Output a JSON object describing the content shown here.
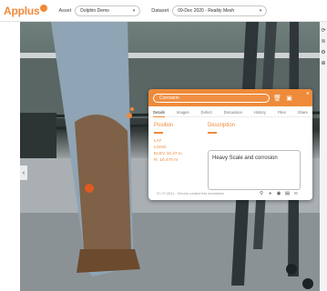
{
  "header": {
    "logo": "Applus",
    "asset_label": "Asset",
    "asset_value": "Dolphin Demo",
    "dataset_label": "Dataset",
    "dataset_value": "09-Dec 2020 - Reality Mesh"
  },
  "toolbar": {
    "icons": [
      "refresh-icon",
      "layers-icon",
      "settings-icon",
      "zoom-icon"
    ]
  },
  "dialog": {
    "title": "Corrosion",
    "tabs": [
      "Details",
      "Images",
      "Defect",
      "Discussion",
      "History",
      "Files",
      "Share"
    ],
    "active_tab": "Details",
    "position_label": "Position",
    "lat_label": "LAT",
    "long_label": "LONG",
    "elev_label": "ELEV 10.47 m",
    "r_label": "R: 10.470 m",
    "description_label": "Description",
    "description_text": "Heavy Scale and corrosion",
    "footer_text": "07-07-2021 - Dennis created this annotation"
  },
  "colors": {
    "accent": "#ee8a3a",
    "header_bg": "#ffffff"
  }
}
